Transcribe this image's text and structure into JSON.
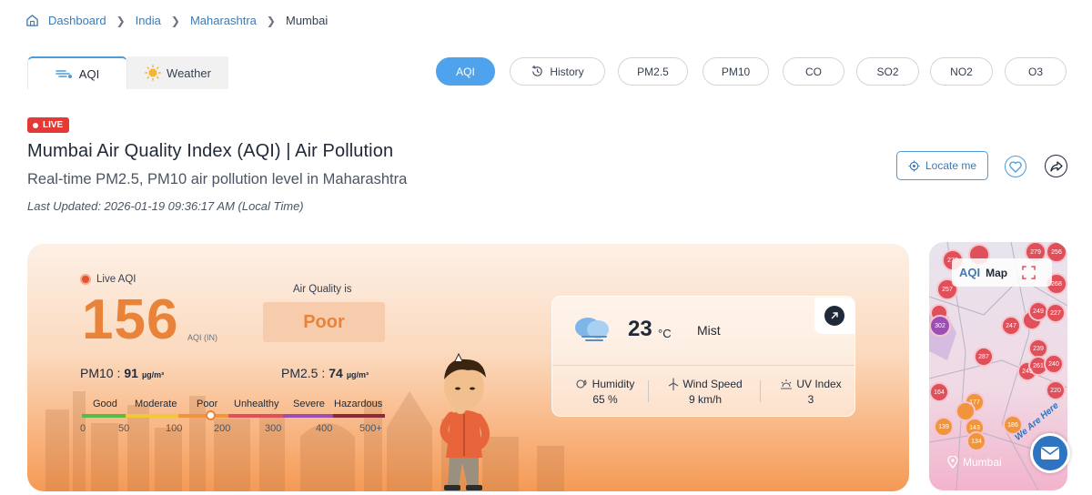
{
  "breadcrumb": {
    "items": [
      "Dashboard",
      "India",
      "Maharashtra"
    ],
    "current": "Mumbai"
  },
  "main_tabs": [
    {
      "label": "AQI",
      "active": true
    },
    {
      "label": "Weather",
      "active": false
    }
  ],
  "pollutant_pills": [
    {
      "label": "AQI",
      "active": true
    },
    {
      "label": "History",
      "active": false
    },
    {
      "label": "PM2.5",
      "active": false
    },
    {
      "label": "PM10",
      "active": false
    },
    {
      "label": "CO",
      "active": false
    },
    {
      "label": "SO2",
      "active": false
    },
    {
      "label": "NO2",
      "active": false
    },
    {
      "label": "O3",
      "active": false
    }
  ],
  "live_badge": "LIVE",
  "title": "Mumbai Air Quality Index (AQI) | Air Pollution",
  "subtitle": "Real-time PM2.5, PM10 air pollution level in Maharashtra",
  "last_updated": "Last Updated: 2026-01-19 09:36:17 AM (Local Time)",
  "actions": {
    "locate_label": "Locate me"
  },
  "aqi": {
    "live_label": "Live AQI",
    "value": "156",
    "unit": "AQI (IN)",
    "quality_label": "Air Quality is",
    "quality": "Poor",
    "pm10_label": "PM10 :",
    "pm10_value": "91",
    "pm10_unit": "µg/m³",
    "pm25_label": "PM2.5 :",
    "pm25_value": "74",
    "pm25_unit": "µg/m³",
    "scale_categories": [
      "Good",
      "Moderate",
      "Poor",
      "Unhealthy",
      "Severe",
      "Hazardous"
    ],
    "scale_ticks": [
      "0",
      "50",
      "100",
      "200",
      "300",
      "400",
      "500+"
    ],
    "colors": {
      "accent": "#e98339",
      "good": "#59b94a",
      "moderate": "#f0c93a",
      "poor": "#f0953b",
      "unhealthy": "#e0505a",
      "severe": "#9c4fb3",
      "hazardous": "#8c2a3a"
    }
  },
  "weather": {
    "temp": "23",
    "temp_unit": "°C",
    "condition": "Mist",
    "humidity_label": "Humidity",
    "humidity_value": "65 %",
    "wind_label": "Wind Speed",
    "wind_value": "9 km/h",
    "uv_label": "UV Index",
    "uv_value": "3"
  },
  "map": {
    "logo": "AQI",
    "label": "Map",
    "city": "Mumbai",
    "badge": "We Are Here",
    "markers": [
      "279",
      "256",
      "270",
      "268",
      "257",
      "302",
      "249",
      "227",
      "247",
      "167",
      "239",
      "287",
      "245",
      "261",
      "240",
      "232",
      "220",
      "164",
      "177",
      "139",
      "143",
      "186",
      "188",
      "134"
    ]
  }
}
